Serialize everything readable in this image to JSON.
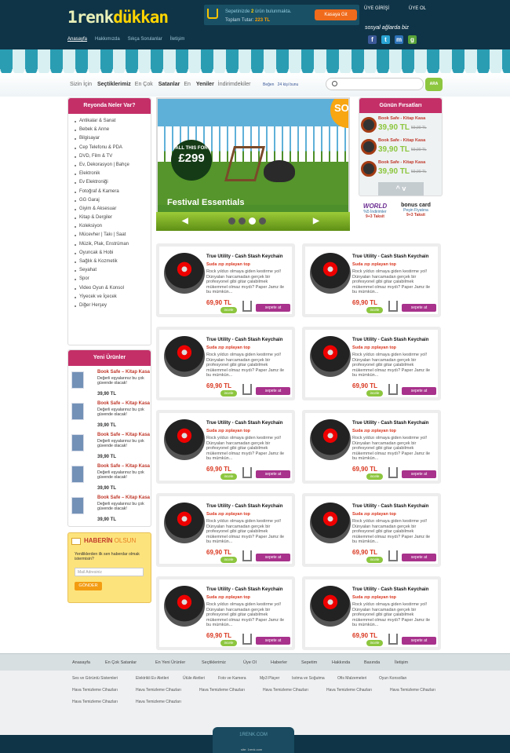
{
  "header": {
    "logo_main": "1renk",
    "logo_accent": "dükkan",
    "cart_line1_pre": "Sepetinizde ",
    "cart_count": "2",
    "cart_line1_post": " ürün bulunmakta.",
    "cart_line2_pre": "Toplam Tutar: ",
    "cart_total": "223 TL",
    "pay_button": "Kasaya Git",
    "login": "ÜYE GİRİŞİ",
    "register": "ÜYE OL",
    "social_title": "sosyal ağlarda biz"
  },
  "top_nav": [
    "Anasayfa",
    "Hakkımızda",
    "Sıkça Sorulanlar",
    "İletişim"
  ],
  "sub_menu": {
    "items": [
      {
        "pre": "Sizin İçin ",
        "bold": "Seçtiklerimiz"
      },
      {
        "pre": "En Çok ",
        "bold": "Satanlar"
      },
      {
        "pre": "En ",
        "bold": "Yeniler"
      },
      {
        "pre": "İndirimdekiler",
        "bold": ""
      }
    ],
    "like": "Beğen",
    "share": "24 kişi bunu",
    "search_placeholder": "",
    "search_button": "ARA"
  },
  "categories": {
    "title": "Reyonda Neler Var?",
    "items": [
      "Antikalar & Sanat",
      "Bebek & Anne",
      "Bilgisayar",
      "Cep Telefonu & PDA",
      "DVD, Film & TV",
      "Ev, Dekorasyon | Bahçe",
      "Elektronik",
      "Ev Elektroniği",
      "Fotoğraf & Kamera",
      "GG Garaj",
      "Giyim & Aksesuar",
      "Kitap & Dergiler",
      "Koleksiyon",
      "Mücevher | Takı | Saat",
      "Müzik, Plak, Enstrüman",
      "Oyuncak & Hobi",
      "Sağlık & Kozmetik",
      "Seyahat",
      "Spor",
      "Video Oyun & Konsol",
      "Yiyecek ve İçecek",
      "Diğer Herşey"
    ]
  },
  "new_products": {
    "title": "Yeni Ürünler",
    "items": [
      {
        "title": "Book Safe – Kitap Kasa",
        "desc": "Değerli eşyalarınız bu çok güvende olacak!",
        "price": "39,90 TL"
      },
      {
        "title": "Book Safe – Kitap Kasa",
        "desc": "Değerli eşyalarınız bu çok güvende olacak!",
        "price": "39,90 TL"
      },
      {
        "title": "Book Safe – Kitap Kasa",
        "desc": "Değerli eşyalarınız bu çok güvende olacak!",
        "price": "39,90 TL"
      },
      {
        "title": "Book Safe – Kitap Kasa",
        "desc": "Değerli eşyalarınız bu çok güvende olacak!",
        "price": "39,90 TL"
      },
      {
        "title": "Book Safe – Kitap Kasa",
        "desc": "Değerli eşyalarınız bu çok güvende olacak!",
        "price": "39,90 TL"
      }
    ]
  },
  "newsletter": {
    "title": "HABERİN",
    "title2": " OLSUN",
    "text": "Yeniliklerden ilk sen haberdar olmak istermisin?",
    "placeholder": "Mail Adresiniz",
    "button": "GÖNDER"
  },
  "slider": {
    "badge_small": "ALL THIS FOR",
    "badge_price": "£299",
    "caption": "Festival Essentials",
    "corner": "SO O"
  },
  "deals": {
    "title": "Günün Fırsatları",
    "items": [
      {
        "title": "Book Safe - Kitap Kasa",
        "price": "39,90 TL",
        "old": "59,90 TL"
      },
      {
        "title": "Book Safe - Kitap Kasa",
        "price": "39,90 TL",
        "old": "59,90 TL"
      },
      {
        "title": "Book Safe - Kitap Kasa",
        "price": "39,90 TL",
        "old": "59,90 TL"
      }
    ],
    "arrows": "^ v"
  },
  "promo": {
    "world": "WORLD",
    "bonus": "bonus card",
    "world_l1": "%5 İndirimler",
    "world_l2": "9+3 Taksit",
    "bonus_l1": "Peşin Fiyatına",
    "bonus_l2": "9+3 Taksit"
  },
  "product": {
    "title": "True Utility - Cash Stash Keychain",
    "subtitle": "Suda zıp zıplayan top",
    "desc": "Rock yıldızı olmaya giden kestirme yol! Dünyaları harcamadan gerçek bir profesyonel gibi gitar çalabilmek mükemmel olmaz mıydı? Paper Jamz ile bu mümkün...",
    "price": "69,90 TL",
    "inspect": "incele",
    "add": "sepete at"
  },
  "footer": {
    "nav": [
      "Anasayfa",
      "En Çok Satanlar",
      "En Yeni Ürünler",
      "Seçtiklerimiz",
      "Üye Ol",
      "Haberler",
      "Sepetim",
      "Hakkında",
      "Basında",
      "İletişim"
    ],
    "row1": [
      "Ses ve Görüntü Sistemleri",
      "Elektrikli Ev Aletleri",
      "Ütüle Aletleri",
      "Foto ve Kamera",
      "Mp3 Player",
      "Isıtma ve Soğutma",
      "Ofis Malzemeleri",
      "Oyun Konsolları"
    ],
    "row2": [
      "Hava Temizleme Cihazları",
      "Hava Temizleme Cihazları",
      "Hava Temizleme Cihazları",
      "Hava Temizleme Cihazları",
      "Hava Temizleme Cihazları",
      "Hava Temizleme Cihazları"
    ],
    "row3": [
      "Hava Temizleme Cihazları",
      "Hava Temizleme Cihazları"
    ],
    "brand": "1RENK.COM",
    "credit": "site: 1renk.com"
  }
}
